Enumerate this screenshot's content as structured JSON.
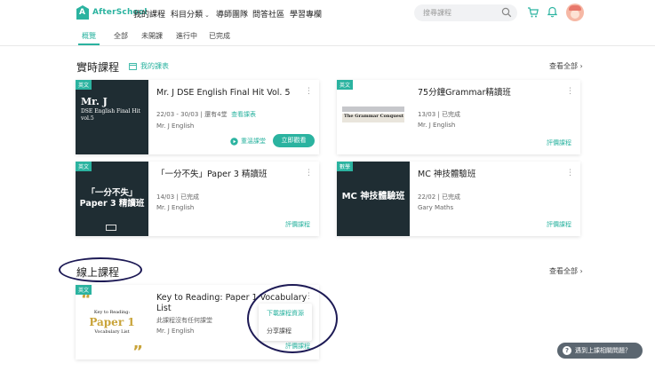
{
  "nav": {
    "brand": "AfterSchool",
    "links": [
      "我的課程",
      "科目分類",
      "導師團隊",
      "問答社區",
      "學習專欄"
    ],
    "search_placeholder": "搜尋課程"
  },
  "tabs": [
    "概覽",
    "全部",
    "未開課",
    "進行中",
    "已完成"
  ],
  "live": {
    "title": "實時課程",
    "my_schedule": "我的課表",
    "see_all": "查看全部",
    "cards": [
      {
        "badge": "英文",
        "title": "Mr. J DSE English Final Hit Vol. 5",
        "dates": "22/03 - 30/03",
        "status": "還有4堂",
        "link": "查看課表",
        "teacher": "Mr. J English",
        "replay": "重溫課堂",
        "enter": "立即觀看",
        "thumb_big": "Mr. J",
        "thumb_small": "DSE English Final Hit vol.5"
      },
      {
        "badge": "英文",
        "title": "75分鐘Grammar精讀班",
        "dates": "13/03",
        "status": "已完成",
        "teacher": "Mr. J English",
        "rate": "評價課程",
        "thumb_big": "The Grammar Conquest"
      },
      {
        "badge": "英文",
        "title": "「一分不失」Paper 3 精讀班",
        "dates": "14/03",
        "status": "已完成",
        "teacher": "Mr. J English",
        "rate": "評價課程",
        "thumb_big": "「一分不失」Paper 3 精讀班"
      },
      {
        "badge": "數學",
        "title": "MC 神技體驗班",
        "dates": "22/02",
        "status": "已完成",
        "teacher": "Gary Maths",
        "rate": "評價課程",
        "thumb_big": "MC 神技體驗班"
      }
    ]
  },
  "online": {
    "title": "線上課程",
    "see_all": "查看全部",
    "cards": [
      {
        "badge": "英文",
        "title": "Key to Reading: Paper 1 Vocabulary List",
        "status": "此課程沒有任何課堂",
        "teacher": "Mr. J English",
        "rate": "評價課程",
        "thumb_k": "Key to Reading:",
        "thumb_p": "Paper 1",
        "thumb_v": "Vocabulary List"
      }
    ],
    "menu": [
      "下載課程資源",
      "分享課程"
    ]
  },
  "help": "遇到上課相關問題？",
  "colors": {
    "accent": "#2bb3a0",
    "dark_thumb": "#1f2d33",
    "annotation": "#1d1a55"
  }
}
